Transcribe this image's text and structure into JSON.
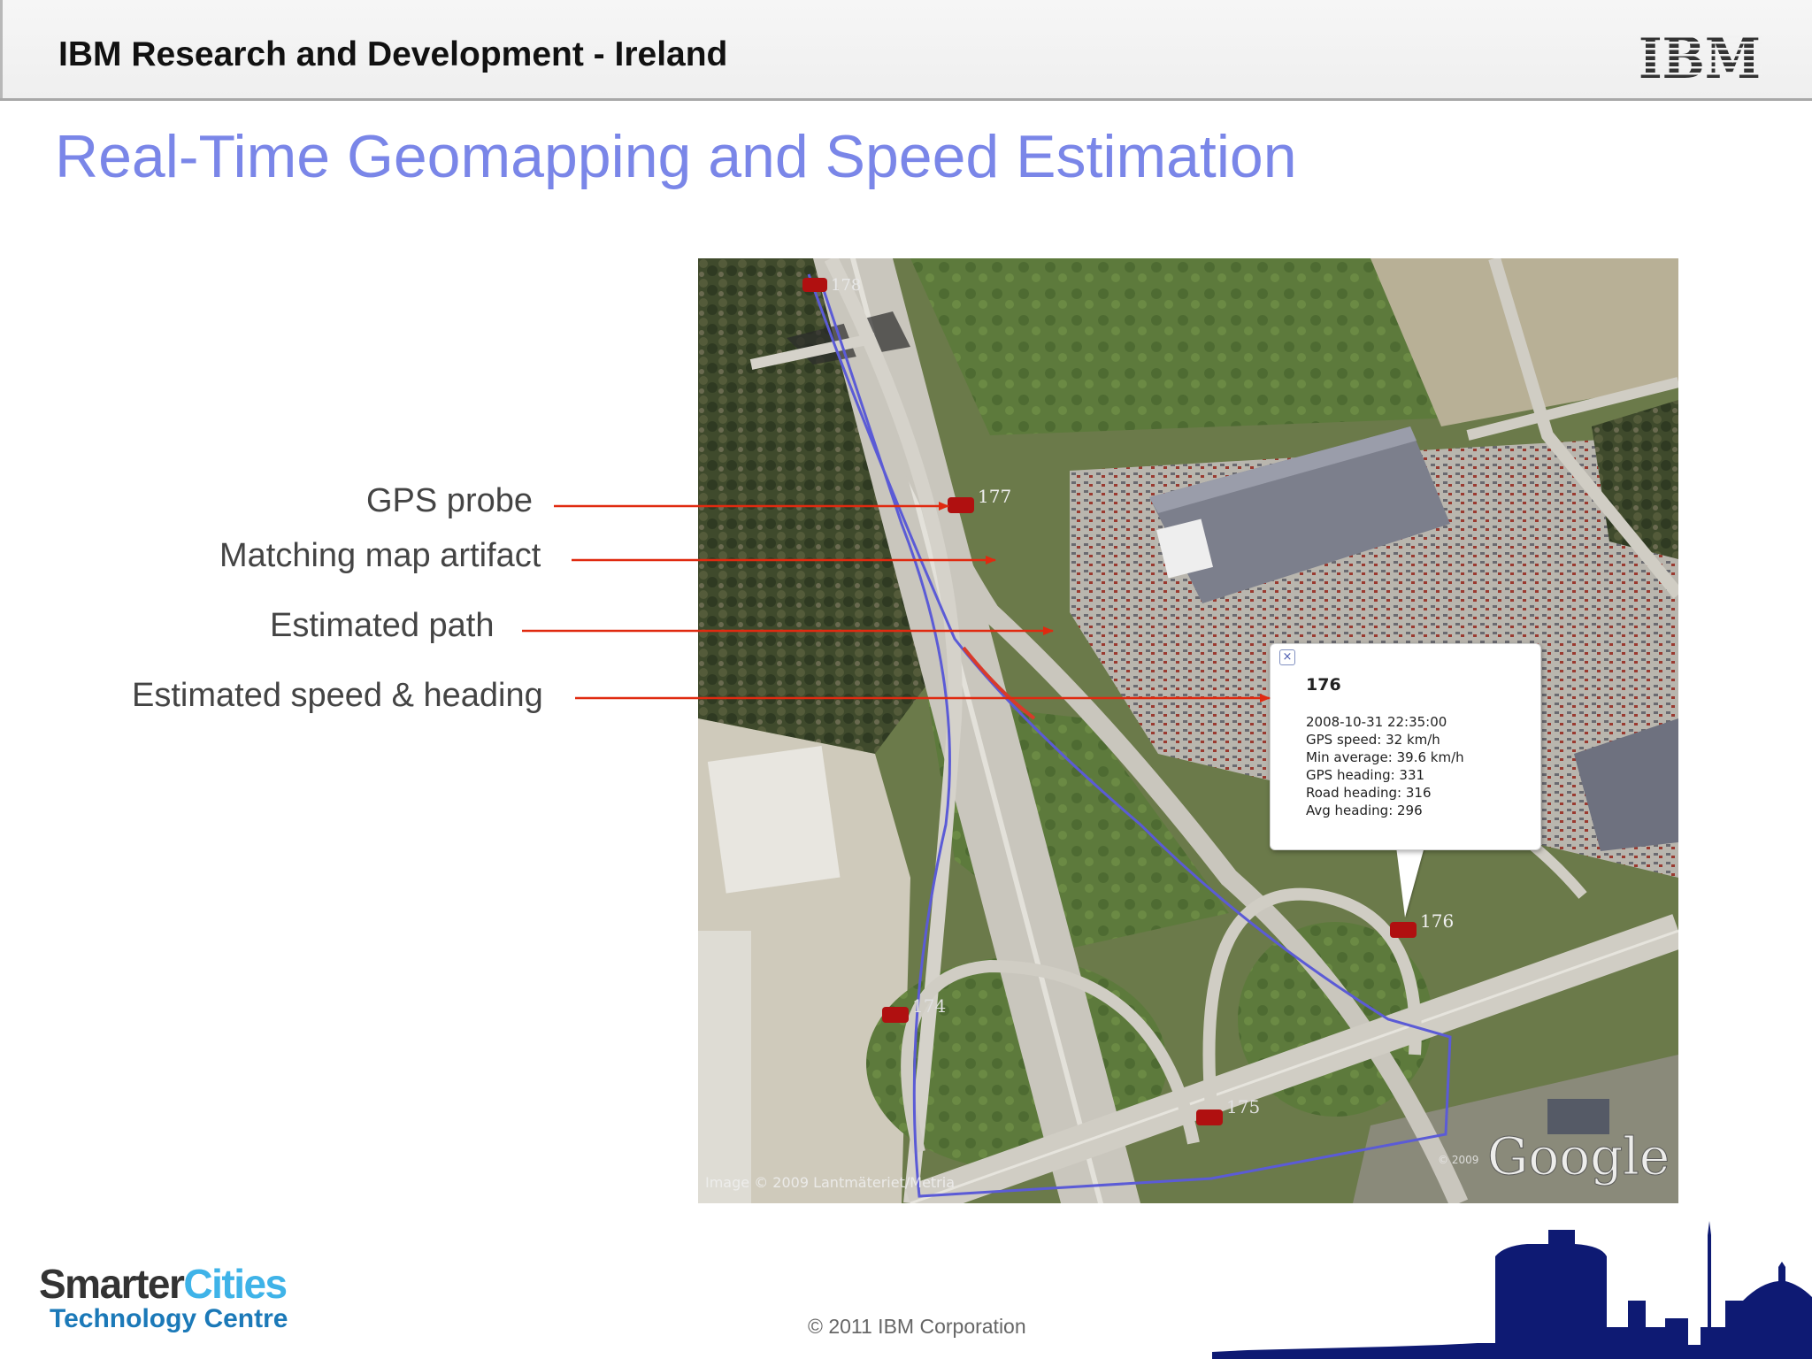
{
  "header": {
    "title": "IBM Research and Development - Ireland",
    "logo_text": "IBM"
  },
  "slide": {
    "title": "Real-Time Geomapping and Speed Estimation"
  },
  "annotations": [
    {
      "label": "GPS probe"
    },
    {
      "label": "Matching map artifact"
    },
    {
      "label": "Estimated path"
    },
    {
      "label": "Estimated speed & heading"
    }
  ],
  "map": {
    "vehicles": [
      {
        "id": "178"
      },
      {
        "id": "177"
      },
      {
        "id": "176"
      },
      {
        "id": "174"
      },
      {
        "id": "175"
      }
    ],
    "popup": {
      "title": "176",
      "close_icon": "close-icon",
      "lines": [
        "2008-10-31 22:35:00",
        "GPS speed: 32 km/h",
        "Min average: 39.6 km/h",
        "GPS heading: 331",
        "Road heading: 316",
        "Avg heading: 296"
      ]
    },
    "imagery_credit": "Image © 2009 Lantmäteriet/Metria",
    "google_year": "© 2009",
    "google_logo": "Google"
  },
  "footer": {
    "logo_smarter": "Smarter",
    "logo_cities": "Cities",
    "logo_subtitle": "Technology Centre",
    "copyright": "© 2011 IBM Corporation"
  },
  "colors": {
    "title": "#7a86e8",
    "arrow": "#e02a10",
    "path": "#5b5bd6",
    "vehicle": "#b01010",
    "skyline": "#0e1a73",
    "cities": "#3fb3e8",
    "subtitle": "#1b79b8"
  }
}
